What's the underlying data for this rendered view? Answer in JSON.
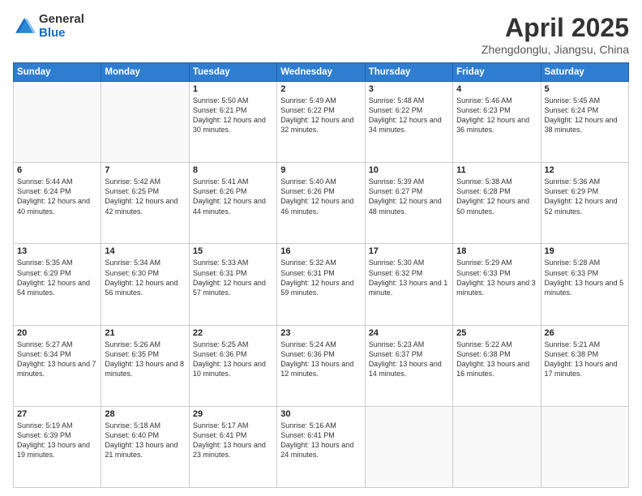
{
  "logo": {
    "general": "General",
    "blue": "Blue"
  },
  "title": "April 2025",
  "location": "Zhengdonglu, Jiangsu, China",
  "weekdays": [
    "Sunday",
    "Monday",
    "Tuesday",
    "Wednesday",
    "Thursday",
    "Friday",
    "Saturday"
  ],
  "weeks": [
    [
      {
        "day": "",
        "info": ""
      },
      {
        "day": "",
        "info": ""
      },
      {
        "day": "1",
        "info": "Sunrise: 5:50 AM\nSunset: 6:21 PM\nDaylight: 12 hours and 30 minutes."
      },
      {
        "day": "2",
        "info": "Sunrise: 5:49 AM\nSunset: 6:22 PM\nDaylight: 12 hours and 32 minutes."
      },
      {
        "day": "3",
        "info": "Sunrise: 5:48 AM\nSunset: 6:22 PM\nDaylight: 12 hours and 34 minutes."
      },
      {
        "day": "4",
        "info": "Sunrise: 5:46 AM\nSunset: 6:23 PM\nDaylight: 12 hours and 36 minutes."
      },
      {
        "day": "5",
        "info": "Sunrise: 5:45 AM\nSunset: 6:24 PM\nDaylight: 12 hours and 38 minutes."
      }
    ],
    [
      {
        "day": "6",
        "info": "Sunrise: 5:44 AM\nSunset: 6:24 PM\nDaylight: 12 hours and 40 minutes."
      },
      {
        "day": "7",
        "info": "Sunrise: 5:42 AM\nSunset: 6:25 PM\nDaylight: 12 hours and 42 minutes."
      },
      {
        "day": "8",
        "info": "Sunrise: 5:41 AM\nSunset: 6:26 PM\nDaylight: 12 hours and 44 minutes."
      },
      {
        "day": "9",
        "info": "Sunrise: 5:40 AM\nSunset: 6:26 PM\nDaylight: 12 hours and 46 minutes."
      },
      {
        "day": "10",
        "info": "Sunrise: 5:39 AM\nSunset: 6:27 PM\nDaylight: 12 hours and 48 minutes."
      },
      {
        "day": "11",
        "info": "Sunrise: 5:38 AM\nSunset: 6:28 PM\nDaylight: 12 hours and 50 minutes."
      },
      {
        "day": "12",
        "info": "Sunrise: 5:36 AM\nSunset: 6:29 PM\nDaylight: 12 hours and 52 minutes."
      }
    ],
    [
      {
        "day": "13",
        "info": "Sunrise: 5:35 AM\nSunset: 6:29 PM\nDaylight: 12 hours and 54 minutes."
      },
      {
        "day": "14",
        "info": "Sunrise: 5:34 AM\nSunset: 6:30 PM\nDaylight: 12 hours and 56 minutes."
      },
      {
        "day": "15",
        "info": "Sunrise: 5:33 AM\nSunset: 6:31 PM\nDaylight: 12 hours and 57 minutes."
      },
      {
        "day": "16",
        "info": "Sunrise: 5:32 AM\nSunset: 6:31 PM\nDaylight: 12 hours and 59 minutes."
      },
      {
        "day": "17",
        "info": "Sunrise: 5:30 AM\nSunset: 6:32 PM\nDaylight: 13 hours and 1 minute."
      },
      {
        "day": "18",
        "info": "Sunrise: 5:29 AM\nSunset: 6:33 PM\nDaylight: 13 hours and 3 minutes."
      },
      {
        "day": "19",
        "info": "Sunrise: 5:28 AM\nSunset: 6:33 PM\nDaylight: 13 hours and 5 minutes."
      }
    ],
    [
      {
        "day": "20",
        "info": "Sunrise: 5:27 AM\nSunset: 6:34 PM\nDaylight: 13 hours and 7 minutes."
      },
      {
        "day": "21",
        "info": "Sunrise: 5:26 AM\nSunset: 6:35 PM\nDaylight: 13 hours and 8 minutes."
      },
      {
        "day": "22",
        "info": "Sunrise: 5:25 AM\nSunset: 6:36 PM\nDaylight: 13 hours and 10 minutes."
      },
      {
        "day": "23",
        "info": "Sunrise: 5:24 AM\nSunset: 6:36 PM\nDaylight: 13 hours and 12 minutes."
      },
      {
        "day": "24",
        "info": "Sunrise: 5:23 AM\nSunset: 6:37 PM\nDaylight: 13 hours and 14 minutes."
      },
      {
        "day": "25",
        "info": "Sunrise: 5:22 AM\nSunset: 6:38 PM\nDaylight: 13 hours and 16 minutes."
      },
      {
        "day": "26",
        "info": "Sunrise: 5:21 AM\nSunset: 6:38 PM\nDaylight: 13 hours and 17 minutes."
      }
    ],
    [
      {
        "day": "27",
        "info": "Sunrise: 5:19 AM\nSunset: 6:39 PM\nDaylight: 13 hours and 19 minutes."
      },
      {
        "day": "28",
        "info": "Sunrise: 5:18 AM\nSunset: 6:40 PM\nDaylight: 13 hours and 21 minutes."
      },
      {
        "day": "29",
        "info": "Sunrise: 5:17 AM\nSunset: 6:41 PM\nDaylight: 13 hours and 23 minutes."
      },
      {
        "day": "30",
        "info": "Sunrise: 5:16 AM\nSunset: 6:41 PM\nDaylight: 13 hours and 24 minutes."
      },
      {
        "day": "",
        "info": ""
      },
      {
        "day": "",
        "info": ""
      },
      {
        "day": "",
        "info": ""
      }
    ]
  ]
}
